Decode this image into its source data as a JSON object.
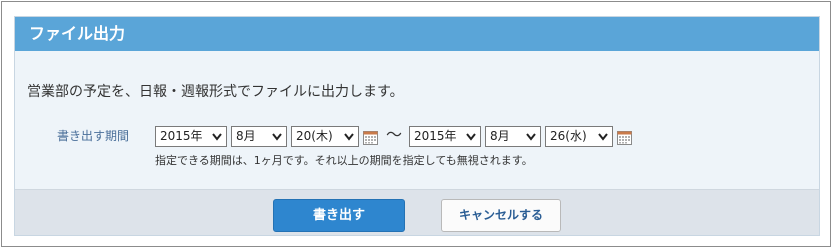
{
  "dialog": {
    "title": "ファイル出力",
    "description": "営業部の予定を、日報・週報形式でファイルに出力します。"
  },
  "period": {
    "label": "書き出す期間",
    "start": {
      "year": "2015年",
      "month": "8月",
      "day": "20(木)"
    },
    "separator": "〜",
    "end": {
      "year": "2015年",
      "month": "8月",
      "day": "26(水)"
    },
    "note": "指定できる期間は、1ヶ月です。それ以上の期間を指定しても無視されます。"
  },
  "buttons": {
    "export_label": "書き出す",
    "cancel_label": "キャンセルする"
  },
  "colors": {
    "header": "#5aa5d8",
    "primary_button": "#2e86cf",
    "footer": "#dde3ea",
    "body": "#eef4f9"
  }
}
